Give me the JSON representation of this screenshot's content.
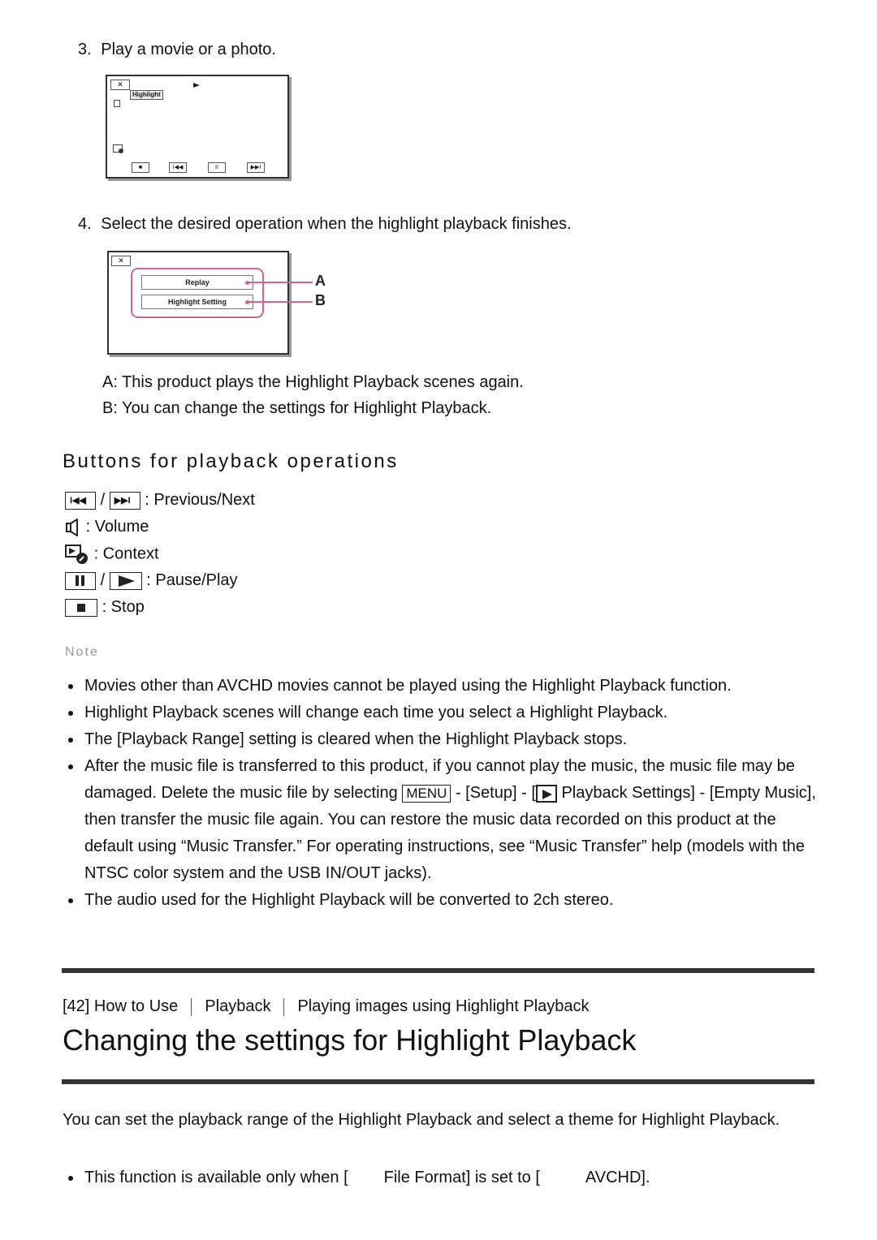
{
  "steps": [
    {
      "number": "3.",
      "text": "Play a movie or a photo."
    },
    {
      "number": "4.",
      "text": "Select the desired operation when the highlight playback finishes."
    }
  ],
  "screen1": {
    "close_label": "✕",
    "highlight_tag": "Highlight",
    "controls": [
      "■",
      "I◀◀",
      "II",
      "▶▶I"
    ]
  },
  "screen2": {
    "close_label": "✕",
    "buttons": [
      "Replay",
      "Highlight Setting"
    ],
    "callouts": [
      "A",
      "B"
    ]
  },
  "callout_descriptions": [
    "A: This product plays the Highlight Playback scenes again.",
    "B: You can change the settings for Highlight Playback."
  ],
  "buttons_section": {
    "heading": "Buttons for playback operations",
    "items": [
      {
        "icons": [
          "previous-icon",
          "next-icon"
        ],
        "label": ": Previous/Next"
      },
      {
        "icons": [
          "volume-icon"
        ],
        "label": ": Volume"
      },
      {
        "icons": [
          "context-icon"
        ],
        "label": ": Context"
      },
      {
        "icons": [
          "pause-icon",
          "play-icon"
        ],
        "label": ": Pause/Play"
      },
      {
        "icons": [
          "stop-icon"
        ],
        "label": ": Stop"
      }
    ],
    "slash": "/"
  },
  "note": {
    "heading": "Note",
    "items": [
      "Movies other than AVCHD movies cannot be played using the Highlight Playback function.",
      "Highlight Playback scenes will change each time you select a Highlight Playback.",
      "The [Playback Range] setting is cleared when the Highlight Playback stops."
    ],
    "music_item": {
      "part1": "After the music file is transferred to this product, if you cannot play the music, the music file may be damaged. Delete the music file by selecting ",
      "menu_key": "MENU",
      "part2": " - [Setup] - [",
      "part3": "Playback Settings] - [Empty Music], then transfer the music file again. You can restore the music data recorded on this product at the default using “Music Transfer.” For operating instructions, see “Music Transfer” help (models with the NTSC color system and the USB IN/OUT jacks)."
    },
    "last_item": "The audio used for the Highlight Playback will be converted to 2ch stereo."
  },
  "breadcrumb": [
    "[42] How to Use",
    "Playback",
    "Playing images using Highlight Playback"
  ],
  "page_title": "Changing the settings for Highlight Playback",
  "intro": "You can set the playback range of the Highlight Playback and select a theme for Highlight Playback.",
  "availability": {
    "part1": "This function is available only when [",
    "part2": "File Format] is set to [",
    "part3": "AVCHD]."
  }
}
